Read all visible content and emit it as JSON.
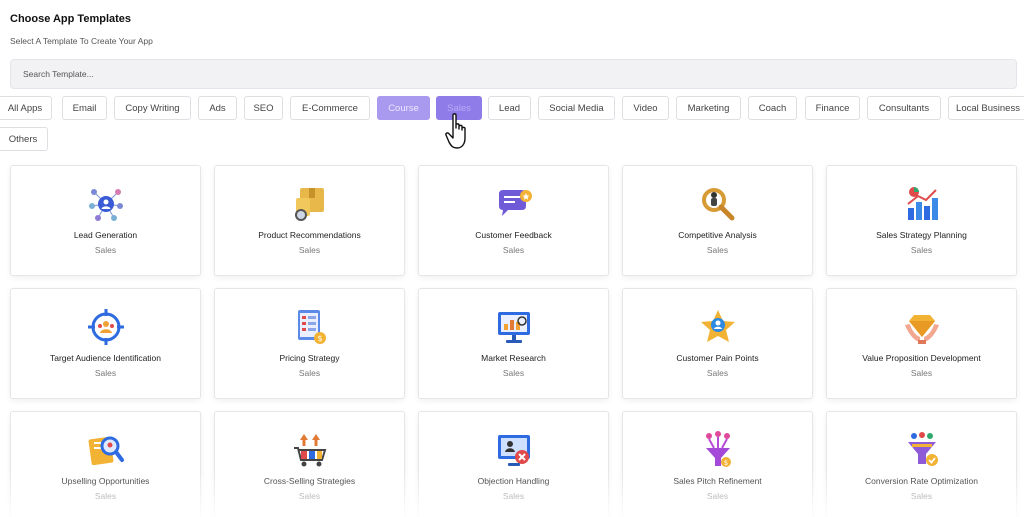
{
  "header": {
    "title": "Choose App Templates",
    "subtitle": "Select A Template To Create Your App"
  },
  "search": {
    "placeholder": "Search Template..."
  },
  "filters": [
    {
      "label": "All Apps"
    },
    {
      "label": "Email"
    },
    {
      "label": "Copy Writing"
    },
    {
      "label": "Ads"
    },
    {
      "label": "SEO"
    },
    {
      "label": "E-Commerce"
    },
    {
      "label": "Course"
    },
    {
      "label": "Sales"
    },
    {
      "label": "Lead"
    },
    {
      "label": "Social Media"
    },
    {
      "label": "Video"
    },
    {
      "label": "Marketing"
    },
    {
      "label": "Coach"
    },
    {
      "label": "Finance"
    },
    {
      "label": "Consultants"
    },
    {
      "label": "Local Business"
    },
    {
      "label": "Others"
    }
  ],
  "templates": [
    {
      "name": "Lead Generation",
      "category": "Sales",
      "icon": "network-icon"
    },
    {
      "name": "Product Recommendations",
      "category": "Sales",
      "icon": "package-icon"
    },
    {
      "name": "Customer Feedback",
      "category": "Sales",
      "icon": "chat-bubble-icon"
    },
    {
      "name": "Competitive Analysis",
      "category": "Sales",
      "icon": "magnifier-icon"
    },
    {
      "name": "Sales Strategy Planning",
      "category": "Sales",
      "icon": "bar-chart-icon"
    },
    {
      "name": "Target Audience Identification",
      "category": "Sales",
      "icon": "target-icon"
    },
    {
      "name": "Pricing Strategy",
      "category": "Sales",
      "icon": "checklist-icon"
    },
    {
      "name": "Market Research",
      "category": "Sales",
      "icon": "monitor-chart-icon"
    },
    {
      "name": "Customer Pain Points",
      "category": "Sales",
      "icon": "star-badge-icon"
    },
    {
      "name": "Value Proposition Development",
      "category": "Sales",
      "icon": "hands-diamond-icon"
    },
    {
      "name": "Upselling Opportunities",
      "category": "Sales",
      "icon": "search-document-icon"
    },
    {
      "name": "Cross-Selling Strategies",
      "category": "Sales",
      "icon": "cart-arrows-icon"
    },
    {
      "name": "Objection Handling",
      "category": "Sales",
      "icon": "screen-user-icon"
    },
    {
      "name": "Sales Pitch Refinement",
      "category": "Sales",
      "icon": "funnel-spark-icon"
    },
    {
      "name": "Conversion Rate Optimization",
      "category": "Sales",
      "icon": "funnel-people-icon"
    }
  ],
  "colors": {
    "accent": "#8f7ce9",
    "accent_light": "#a99af0",
    "card_border": "#e6e6ea"
  }
}
